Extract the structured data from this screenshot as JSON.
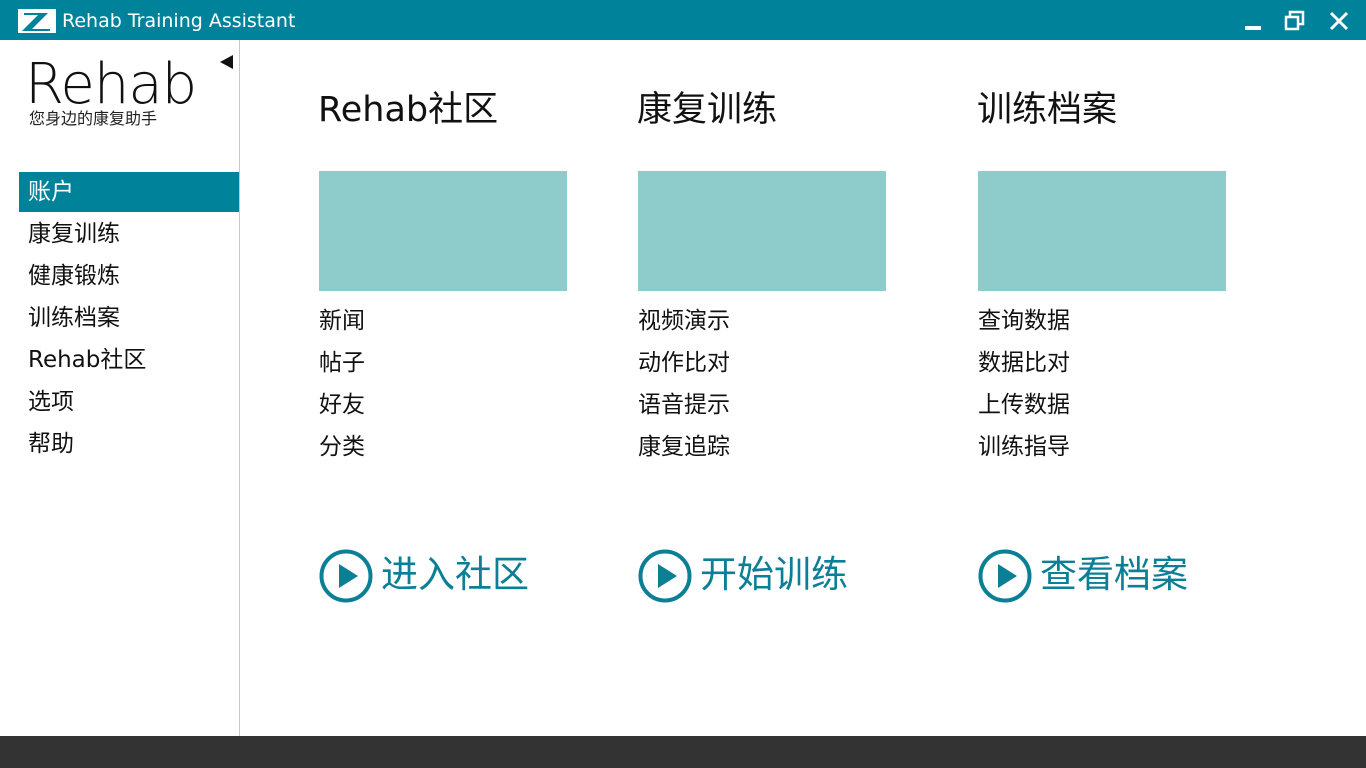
{
  "window": {
    "title": "Rehab Training Assistant",
    "accent": "#00839a",
    "buttons": [
      "minimize-icon",
      "restore-icon",
      "close-icon"
    ]
  },
  "sidebar": {
    "brand": "Rehab",
    "tagline": "您身边的康复助手",
    "collapse_icon": "triangle-left-icon",
    "items": [
      {
        "label": "账户",
        "active": true
      },
      {
        "label": "康复训练",
        "active": false
      },
      {
        "label": "健康锻炼",
        "active": false
      },
      {
        "label": "训练档案",
        "active": false
      },
      {
        "label": "Rehab社区",
        "active": false
      },
      {
        "label": "选项",
        "active": false
      },
      {
        "label": "帮助",
        "active": false
      }
    ]
  },
  "columns": [
    {
      "title": "Rehab社区",
      "links": [
        "新闻",
        "帖子",
        "好友",
        "分类"
      ],
      "action": "进入社区"
    },
    {
      "title": "康复训练",
      "links": [
        "视频演示",
        "动作比对",
        "语音提示",
        "康复追踪"
      ],
      "action": "开始训练"
    },
    {
      "title": "训练档案",
      "links": [
        "查询数据",
        "数据比对",
        "上传数据",
        "训练指导"
      ],
      "action": "查看档案"
    }
  ],
  "colors": {
    "tile": "#8ecbcb",
    "action_text": "#0a7f96",
    "bottom_bar": "#333333"
  }
}
